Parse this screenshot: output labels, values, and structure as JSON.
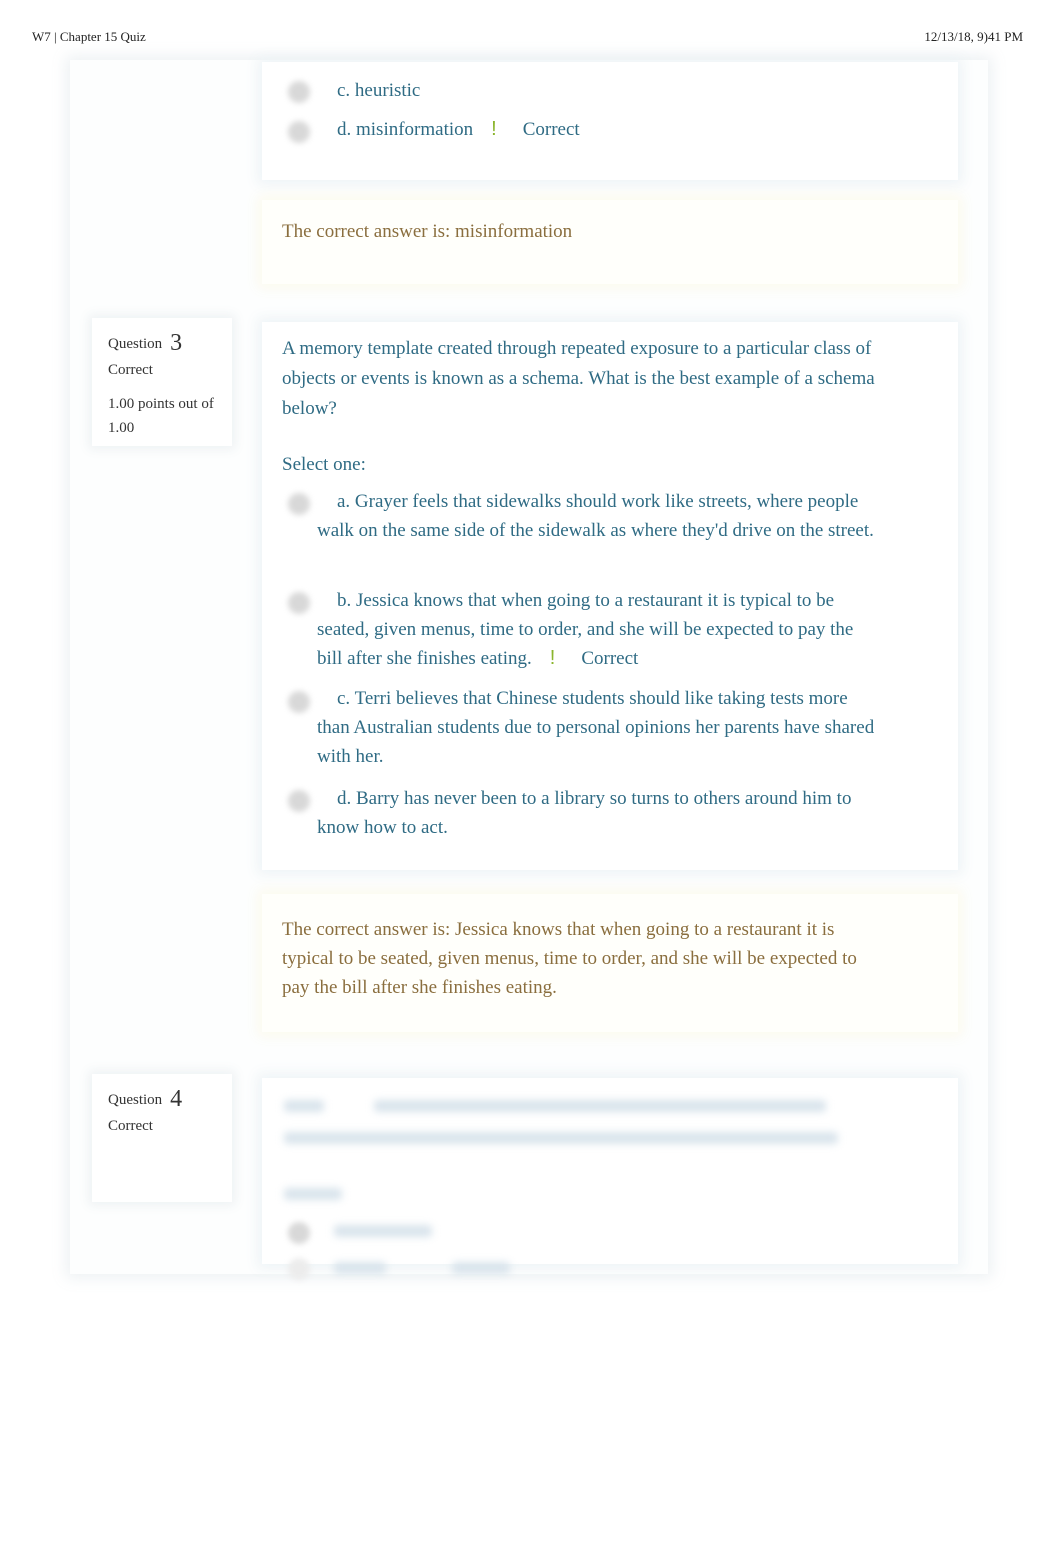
{
  "print_header": {
    "title": "W7 | Chapter 15 Quiz",
    "timestamp": "12/13/18, 9)41 PM"
  },
  "colors": {
    "question_text": "#2f6b84",
    "feedback_text": "#8a6e3e",
    "correct_mark": "#8bb52d",
    "info_text": "#333333"
  },
  "question2_tail": {
    "options": [
      {
        "label": "c. heuristic",
        "selected": false,
        "correct": false
      },
      {
        "label": "d. misinformation",
        "selected": true,
        "correct": true,
        "mark": "!",
        "status": "Correct"
      }
    ],
    "feedback": "The correct answer is: misinformation"
  },
  "question3": {
    "label": "Question",
    "number": "3",
    "state": "Correct",
    "grade": "1.00 points out of 1.00",
    "text": "A memory template created through repeated exposure to a particular class of objects or events is known as a schema. What is the best example of a schema below?",
    "prompt": "Select one:",
    "options": [
      {
        "label": "a. Grayer feels that sidewalks should work like streets, where people walk on the same side of the sidewalk as where they'd drive on the street.",
        "selected": false,
        "correct": false
      },
      {
        "label": "b. Jessica knows that when going to a restaurant it is typical to be seated, given menus, time to order, and she will be expected to pay the bill after she finishes eating.",
        "selected": true,
        "correct": true,
        "mark": "!",
        "status": "Correct"
      },
      {
        "label": "c. Terri believes that Chinese students should like taking tests more than Australian students due to personal opinions her parents have shared with her.",
        "selected": false,
        "correct": false
      },
      {
        "label": "d. Barry has never been to a library so turns to others around him to know how to act.",
        "selected": false,
        "correct": false
      }
    ],
    "feedback": "The correct answer is: Jessica knows that when going to a restaurant it is typical to be seated, given menus, time to order, and she will be expected to pay the bill after she finishes eating."
  },
  "question4": {
    "label": "Question",
    "number": "4",
    "state": "Correct"
  }
}
